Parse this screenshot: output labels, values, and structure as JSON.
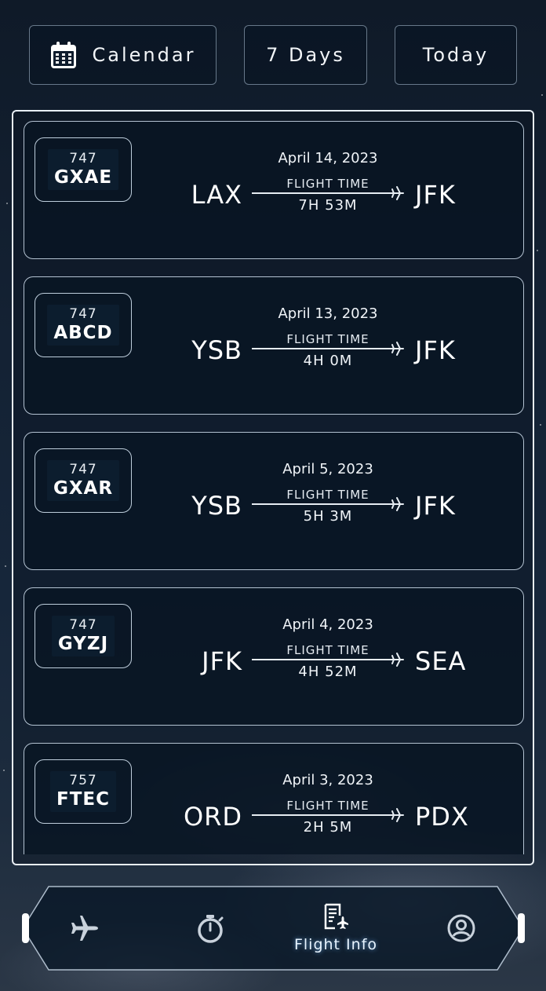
{
  "top_bar": {
    "calendar_label": "Calendar",
    "calendar_icon": "calendar-icon",
    "seven_days_label": "7 Days",
    "today_label": "Today"
  },
  "flights": [
    {
      "model": "747",
      "registration": "GXAE",
      "date": "April 14, 2023",
      "origin": "LAX",
      "destination": "JFK",
      "flight_time_label": "FLIGHT TIME",
      "duration": "7H 53M"
    },
    {
      "model": "747",
      "registration": "ABCD",
      "date": "April 13, 2023",
      "origin": "YSB",
      "destination": "JFK",
      "flight_time_label": "FLIGHT TIME",
      "duration": "4H 0M"
    },
    {
      "model": "747",
      "registration": "GXAR",
      "date": "April 5, 2023",
      "origin": "YSB",
      "destination": "JFK",
      "flight_time_label": "FLIGHT TIME",
      "duration": "5H 3M"
    },
    {
      "model": "747",
      "registration": "GYZJ",
      "date": "April 4, 2023",
      "origin": "JFK",
      "destination": "SEA",
      "flight_time_label": "FLIGHT TIME",
      "duration": "4H 52M"
    },
    {
      "model": "757",
      "registration": "FTEC",
      "date": "April 3, 2023",
      "origin": "ORD",
      "destination": "PDX",
      "flight_time_label": "FLIGHT TIME",
      "duration": "2H 5M"
    }
  ],
  "nav": {
    "items": [
      {
        "icon": "airplane-icon",
        "label": ""
      },
      {
        "icon": "stopwatch-icon",
        "label": ""
      },
      {
        "icon": "flight-info-icon",
        "label": "Flight Info",
        "active": true
      },
      {
        "icon": "profile-icon",
        "label": ""
      }
    ]
  },
  "colors": {
    "background": "#142234",
    "card_border": "#d2e1f0",
    "text": "#ffffff",
    "active_glow": "#78beff"
  }
}
